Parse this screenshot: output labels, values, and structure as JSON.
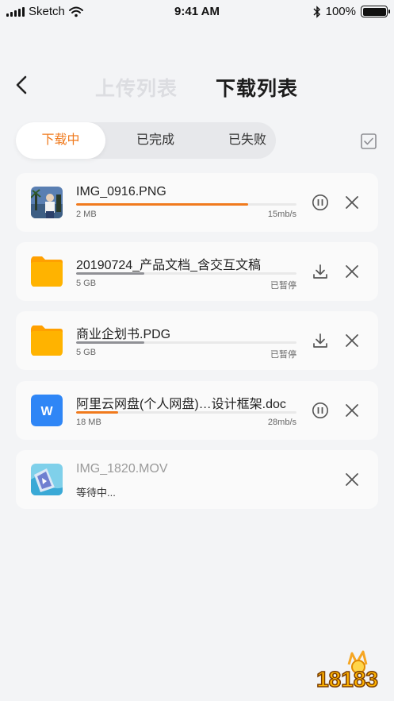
{
  "status_bar": {
    "carrier": "Sketch",
    "time": "9:41 AM",
    "battery": "100%"
  },
  "nav": {
    "upload_tab": "上传列表",
    "download_tab": "下载列表"
  },
  "segments": {
    "downloading": "下载中",
    "completed": "已完成",
    "failed": "已失败"
  },
  "colors": {
    "accent": "#f07a1d",
    "paused": "#8f9095",
    "doc_blue": "#2f86f6",
    "folder": "#ffb300"
  },
  "files": [
    {
      "name": "IMG_0916.PNG",
      "size": "2 MB",
      "status": "15mb/s",
      "progress": 0.78,
      "state": "downloading",
      "icon": "image-thumbnail"
    },
    {
      "name": "20190724_产品文档_含交互文稿",
      "size": "5 GB",
      "status": "已暂停",
      "progress": 0.31,
      "state": "paused",
      "icon": "folder-icon"
    },
    {
      "name": "商业企划书.PDG",
      "size": "5 GB",
      "status": "已暂停",
      "progress": 0.31,
      "state": "paused",
      "icon": "folder-icon"
    },
    {
      "name": "阿里云网盘(个人网盘)…设计框架.doc",
      "size": "18 MB",
      "status": "28mb/s",
      "progress": 0.19,
      "state": "downloading",
      "icon": "word-doc-icon",
      "icon_letter": "W"
    },
    {
      "name": "IMG_1820.MOV",
      "waiting": "等待中...",
      "state": "waiting",
      "icon": "video-thumbnail"
    }
  ],
  "watermark": {
    "text": "18183"
  }
}
